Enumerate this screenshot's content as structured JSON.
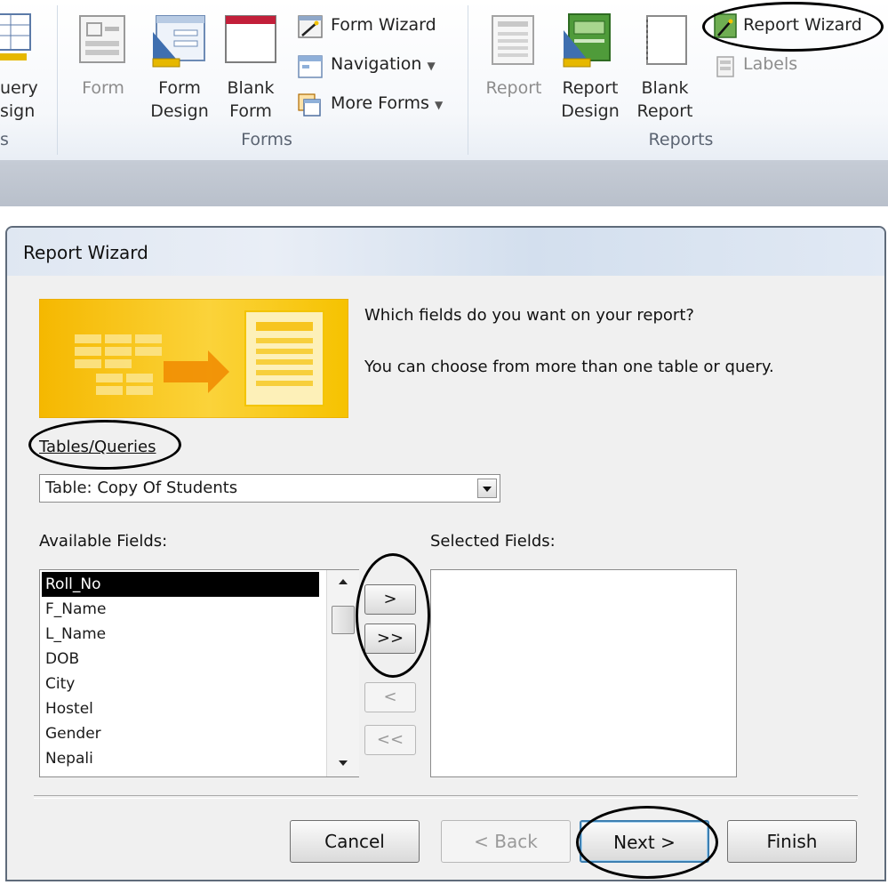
{
  "ribbon": {
    "query_design": "uery\nsign",
    "query_design_line1": "uery",
    "query_design_line2": "sign",
    "query_group_fragment": "s",
    "form": "Form",
    "form_design_line1": "Form",
    "form_design_line2": "Design",
    "blank_form_line1": "Blank",
    "blank_form_line2": "Form",
    "form_wizard": "Form Wizard",
    "navigation": "Navigation",
    "more_forms": "More Forms",
    "forms_group": "Forms",
    "report": "Report",
    "report_design_line1": "Report",
    "report_design_line2": "Design",
    "blank_report_line1": "Blank",
    "blank_report_line2": "Report",
    "report_wizard": "Report Wizard",
    "labels": "Labels",
    "reports_group": "Reports"
  },
  "dialog": {
    "title": "Report Wizard",
    "question": "Which fields do you want on your report?",
    "hint": "You can choose from more than one table or query.",
    "tables_queries_label": "Tables/Queries",
    "tables_queries_value": "Table: Copy Of Students",
    "available_label": "Available Fields:",
    "selected_label": "Selected Fields:",
    "available_fields": [
      "Roll_No",
      "F_Name",
      "L_Name",
      "DOB",
      "City",
      "Hostel",
      "Gender",
      "Nepali"
    ],
    "selected_fields": [],
    "move_buttons": {
      "add_one": ">",
      "add_all": ">>",
      "remove_one": "<",
      "remove_all": "<<"
    },
    "buttons": {
      "cancel": "Cancel",
      "back": "< Back",
      "next": "Next >",
      "finish": "Finish"
    }
  },
  "colors": {
    "banner_yellow": "#f5b800",
    "selection": "#000000",
    "default_button_border": "#3c7fb1"
  }
}
